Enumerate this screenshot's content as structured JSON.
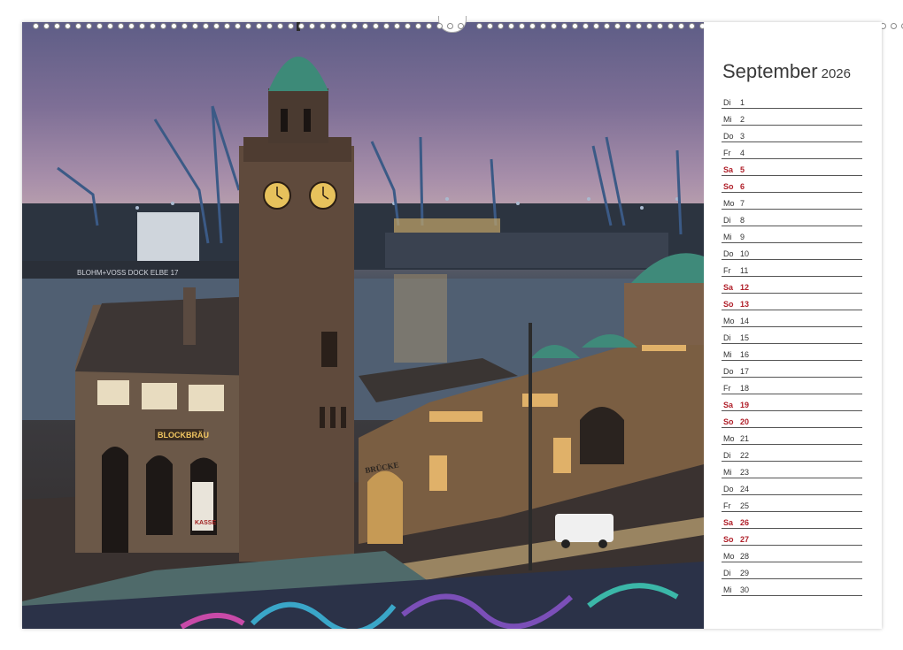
{
  "calendar": {
    "month": "September",
    "year": "2026",
    "weekend_color": "#b0202a",
    "days": [
      {
        "wd": "Di",
        "d": "1",
        "we": false
      },
      {
        "wd": "Mi",
        "d": "2",
        "we": false
      },
      {
        "wd": "Do",
        "d": "3",
        "we": false
      },
      {
        "wd": "Fr",
        "d": "4",
        "we": false
      },
      {
        "wd": "Sa",
        "d": "5",
        "we": true
      },
      {
        "wd": "So",
        "d": "6",
        "we": true
      },
      {
        "wd": "Mo",
        "d": "7",
        "we": false
      },
      {
        "wd": "Di",
        "d": "8",
        "we": false
      },
      {
        "wd": "Mi",
        "d": "9",
        "we": false
      },
      {
        "wd": "Do",
        "d": "10",
        "we": false
      },
      {
        "wd": "Fr",
        "d": "11",
        "we": false
      },
      {
        "wd": "Sa",
        "d": "12",
        "we": true
      },
      {
        "wd": "So",
        "d": "13",
        "we": true
      },
      {
        "wd": "Mo",
        "d": "14",
        "we": false
      },
      {
        "wd": "Di",
        "d": "15",
        "we": false
      },
      {
        "wd": "Mi",
        "d": "16",
        "we": false
      },
      {
        "wd": "Do",
        "d": "17",
        "we": false
      },
      {
        "wd": "Fr",
        "d": "18",
        "we": false
      },
      {
        "wd": "Sa",
        "d": "19",
        "we": true
      },
      {
        "wd": "So",
        "d": "20",
        "we": true
      },
      {
        "wd": "Mo",
        "d": "21",
        "we": false
      },
      {
        "wd": "Di",
        "d": "22",
        "we": false
      },
      {
        "wd": "Mi",
        "d": "23",
        "we": false
      },
      {
        "wd": "Do",
        "d": "24",
        "we": false
      },
      {
        "wd": "Fr",
        "d": "25",
        "we": false
      },
      {
        "wd": "Sa",
        "d": "26",
        "we": true
      },
      {
        "wd": "So",
        "d": "27",
        "we": true
      },
      {
        "wd": "Mo",
        "d": "28",
        "we": false
      },
      {
        "wd": "Di",
        "d": "29",
        "we": false
      },
      {
        "wd": "Mi",
        "d": "30",
        "we": false
      }
    ]
  },
  "photo": {
    "signs": {
      "dock": "BLOHM+VOSS DOCK ELBE 17",
      "brewery": "BLOCKBRÄU",
      "bridge": "BRÜCKE",
      "ticket": "KASSE"
    }
  }
}
